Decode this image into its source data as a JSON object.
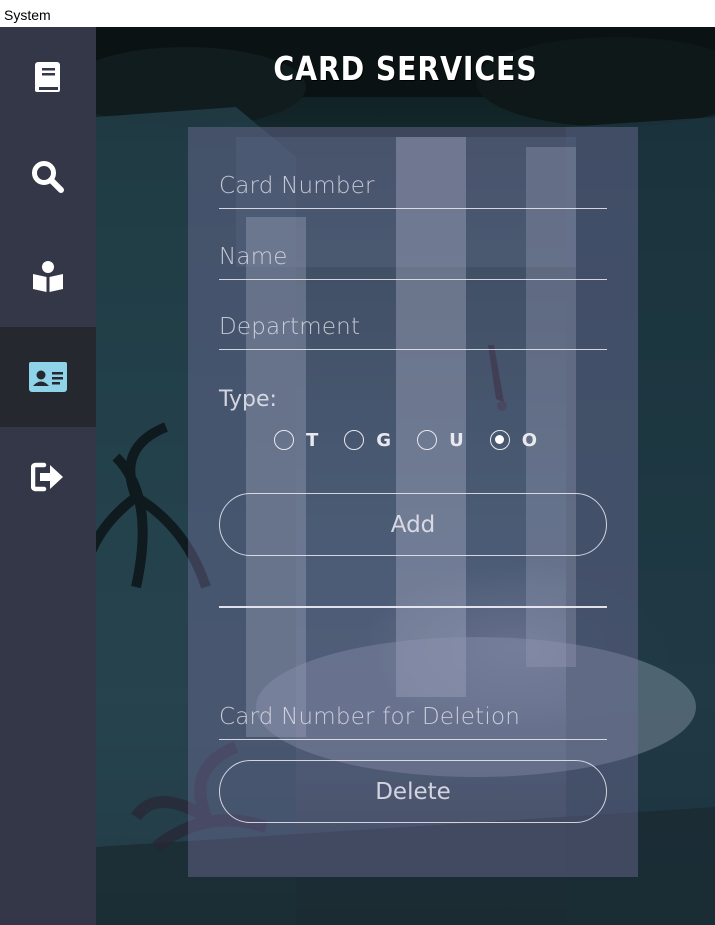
{
  "window": {
    "title": "System"
  },
  "header": {
    "title": "CARD SERVICES"
  },
  "sidebar": {
    "items": [
      {
        "icon": "book-icon",
        "active": false
      },
      {
        "icon": "search-icon",
        "active": false
      },
      {
        "icon": "reader-icon",
        "active": false
      },
      {
        "icon": "id-card-icon",
        "active": true
      },
      {
        "icon": "logout-icon",
        "active": false
      }
    ],
    "active_color": "#8fd3e8"
  },
  "form": {
    "card_number": {
      "placeholder": "Card Number",
      "value": ""
    },
    "name": {
      "placeholder": "Name",
      "value": ""
    },
    "department": {
      "placeholder": "Department",
      "value": ""
    },
    "type_label": "Type:",
    "type_options": [
      "T",
      "G",
      "U",
      "O"
    ],
    "type_selected": "O",
    "add_label": "Add",
    "delete_card_number": {
      "placeholder": "Card Number for Deletion",
      "value": ""
    },
    "delete_label": "Delete"
  }
}
